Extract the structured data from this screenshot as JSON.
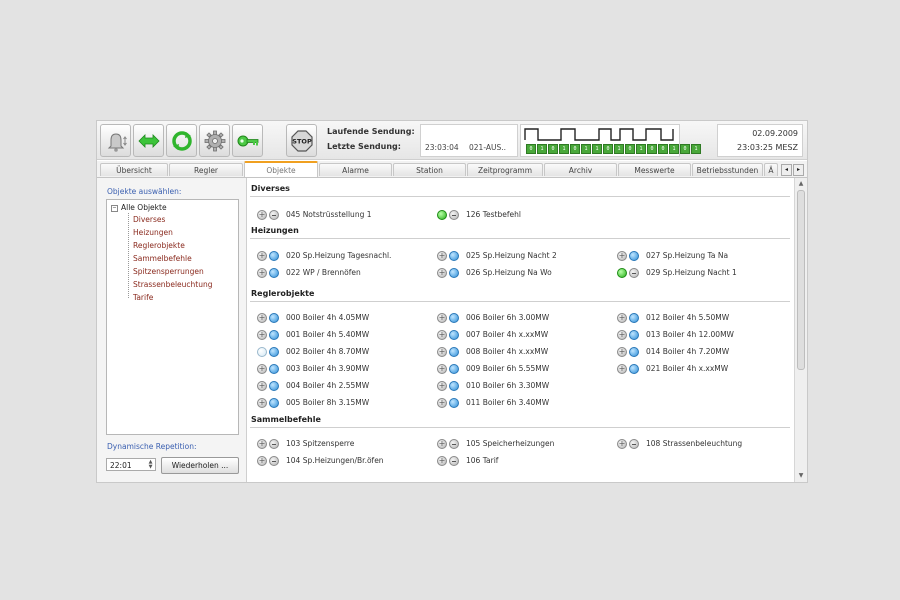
{
  "toolbar": {
    "buttons": [
      {
        "name": "bell-icon",
        "label": "Alarm"
      },
      {
        "name": "transfer-icon",
        "label": "Senden"
      },
      {
        "name": "refresh-icon",
        "label": "Aktualisieren"
      },
      {
        "name": "gear-icon",
        "label": "Einstellungen"
      },
      {
        "name": "key-icon",
        "label": "Login"
      },
      {
        "name": "stop-icon",
        "label": "STOP"
      }
    ],
    "laufende_label": "Laufende Sendung:",
    "letzte_label": "Letzte Sendung:",
    "letzte_time": "23:03:04",
    "letzte_code": "021-AUS..",
    "signal_bits": [
      "0",
      "1",
      "0",
      "1",
      "0",
      "1",
      "1",
      "0",
      "1",
      "0",
      "1",
      "0",
      "0",
      "1",
      "0",
      "1"
    ],
    "date": "02.09.2009",
    "time": "23:03:25 MESZ"
  },
  "tabs": [
    {
      "label": "Übersicht",
      "active": false
    },
    {
      "label": "Regler",
      "active": false
    },
    {
      "label": "Objekte",
      "active": true
    },
    {
      "label": "Alarme",
      "active": false
    },
    {
      "label": "Station",
      "active": false
    },
    {
      "label": "Zeitprogramm",
      "active": false
    },
    {
      "label": "Archiv",
      "active": false
    },
    {
      "label": "Messwerte",
      "active": false
    },
    {
      "label": "Betriebsstunden",
      "active": false
    },
    {
      "label": "Ä",
      "active": false
    }
  ],
  "sidebar": {
    "header": "Objekte auswählen:",
    "root": "Alle Objekte",
    "items": [
      "Diverses",
      "Heizungen",
      "Reglerobjekte",
      "Sammelbefehle",
      "Spitzensperrungen",
      "Strassenbeleuchtung",
      "Tarife"
    ],
    "dyn_label": "Dynamische Repetition:",
    "dyn_time": "22:01",
    "repeat_button": "Wiederholen ..."
  },
  "sections": [
    {
      "title": "Diverses",
      "items": [
        {
          "label": "045 Notstrüsstellung 1",
          "state": "gray"
        },
        {
          "label": "126 Testbefehl",
          "state": "green"
        }
      ]
    },
    {
      "title": "Heizungen",
      "items": [
        {
          "label": "020 Sp.Heizung Tagesnachl.",
          "state": "blue"
        },
        {
          "label": "022 WP / Brennöfen",
          "state": "blue"
        },
        {
          "label": "025 Sp.Heizung Nacht 2",
          "state": "blue"
        },
        {
          "label": "026 Sp.Heizung Na Wo",
          "state": "blue"
        },
        {
          "label": "027 Sp.Heizung Ta Na",
          "state": "blue"
        },
        {
          "label": "029 Sp.Heizung Nacht 1",
          "state": "green"
        }
      ]
    },
    {
      "title": "Reglerobjekte",
      "items": [
        {
          "label": "000 Boiler 4h 4.05MW",
          "state": "blue"
        },
        {
          "label": "001 Boiler 4h 5.40MW",
          "state": "blue"
        },
        {
          "label": "002 Boiler 4h 8.70MW",
          "state": "pale"
        },
        {
          "label": "003 Boiler 4h 3.90MW",
          "state": "blue"
        },
        {
          "label": "004 Boiler 4h 2.55MW",
          "state": "blue"
        },
        {
          "label": "005 Boiler 8h 3.15MW",
          "state": "blue"
        },
        {
          "label": "006 Boiler 6h 3.00MW",
          "state": "blue"
        },
        {
          "label": "007 Boiler 4h x.xxMW",
          "state": "blue"
        },
        {
          "label": "008 Boiler 4h x.xxMW",
          "state": "blue"
        },
        {
          "label": "009 Boiler 6h 5.55MW",
          "state": "blue"
        },
        {
          "label": "010 Boiler 6h 3.30MW",
          "state": "blue"
        },
        {
          "label": "011 Boiler 6h 3.40MW",
          "state": "blue"
        },
        {
          "label": "012 Boiler 4h 5.50MW",
          "state": "blue"
        },
        {
          "label": "013 Boiler 4h 12.00MW",
          "state": "blue"
        },
        {
          "label": "014 Boiler 4h 7.20MW",
          "state": "blue"
        },
        {
          "label": "021 Boiler 4h x.xxMW",
          "state": "blue"
        }
      ]
    },
    {
      "title": "Sammelbefehle",
      "items": [
        {
          "label": "103 Spitzensperre",
          "state": "gray"
        },
        {
          "label": "104 Sp.Heizungen/Br.öfen",
          "state": "gray"
        },
        {
          "label": "105 Speicherheizungen",
          "state": "gray"
        },
        {
          "label": "106 Tarif",
          "state": "gray"
        },
        {
          "label": "108 Strassenbeleuchtung",
          "state": "gray"
        }
      ]
    }
  ]
}
